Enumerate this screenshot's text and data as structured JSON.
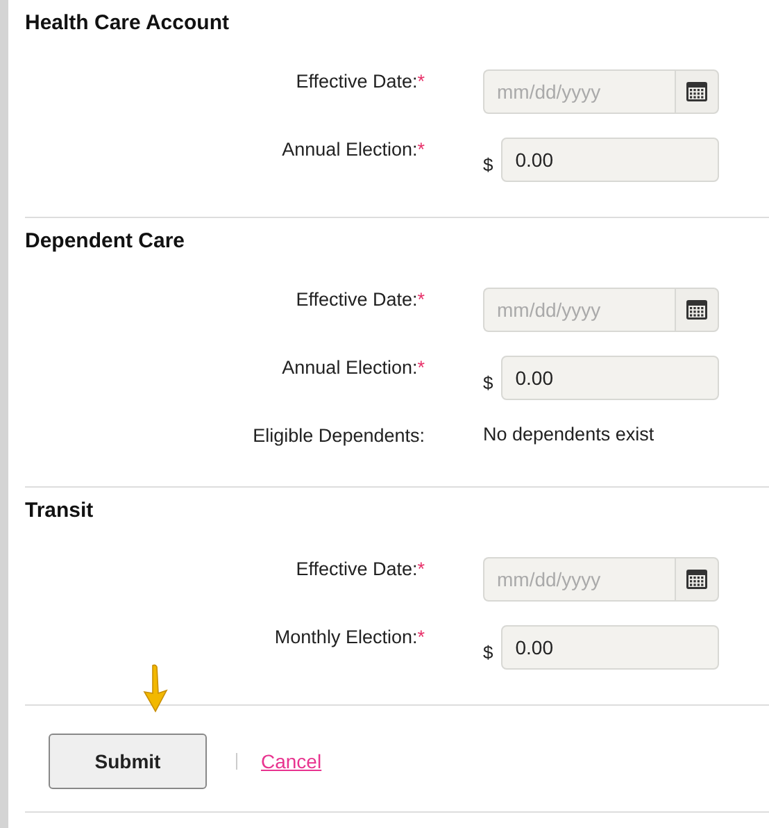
{
  "sections": [
    {
      "title": "Health Care Account",
      "rows": [
        {
          "kind": "date",
          "label": "Effective Date:",
          "required": true,
          "placeholder": "mm/dd/yyyy"
        },
        {
          "kind": "amount",
          "label": "Annual Election:",
          "required": true,
          "currency": "$",
          "value": "0.00"
        }
      ]
    },
    {
      "title": "Dependent Care",
      "rows": [
        {
          "kind": "date",
          "label": "Effective Date:",
          "required": true,
          "placeholder": "mm/dd/yyyy"
        },
        {
          "kind": "amount",
          "label": "Annual Election:",
          "required": true,
          "currency": "$",
          "value": "0.00"
        },
        {
          "kind": "text",
          "label": "Eligible Dependents:",
          "required": false,
          "value": "No dependents exist"
        }
      ]
    },
    {
      "title": "Transit",
      "rows": [
        {
          "kind": "date",
          "label": "Effective Date:",
          "required": true,
          "placeholder": "mm/dd/yyyy"
        },
        {
          "kind": "amount",
          "label": "Monthly Election:",
          "required": true,
          "currency": "$",
          "value": "0.00"
        }
      ]
    }
  ],
  "actions": {
    "submit": "Submit",
    "cancel": "Cancel"
  },
  "required_mark": "*"
}
